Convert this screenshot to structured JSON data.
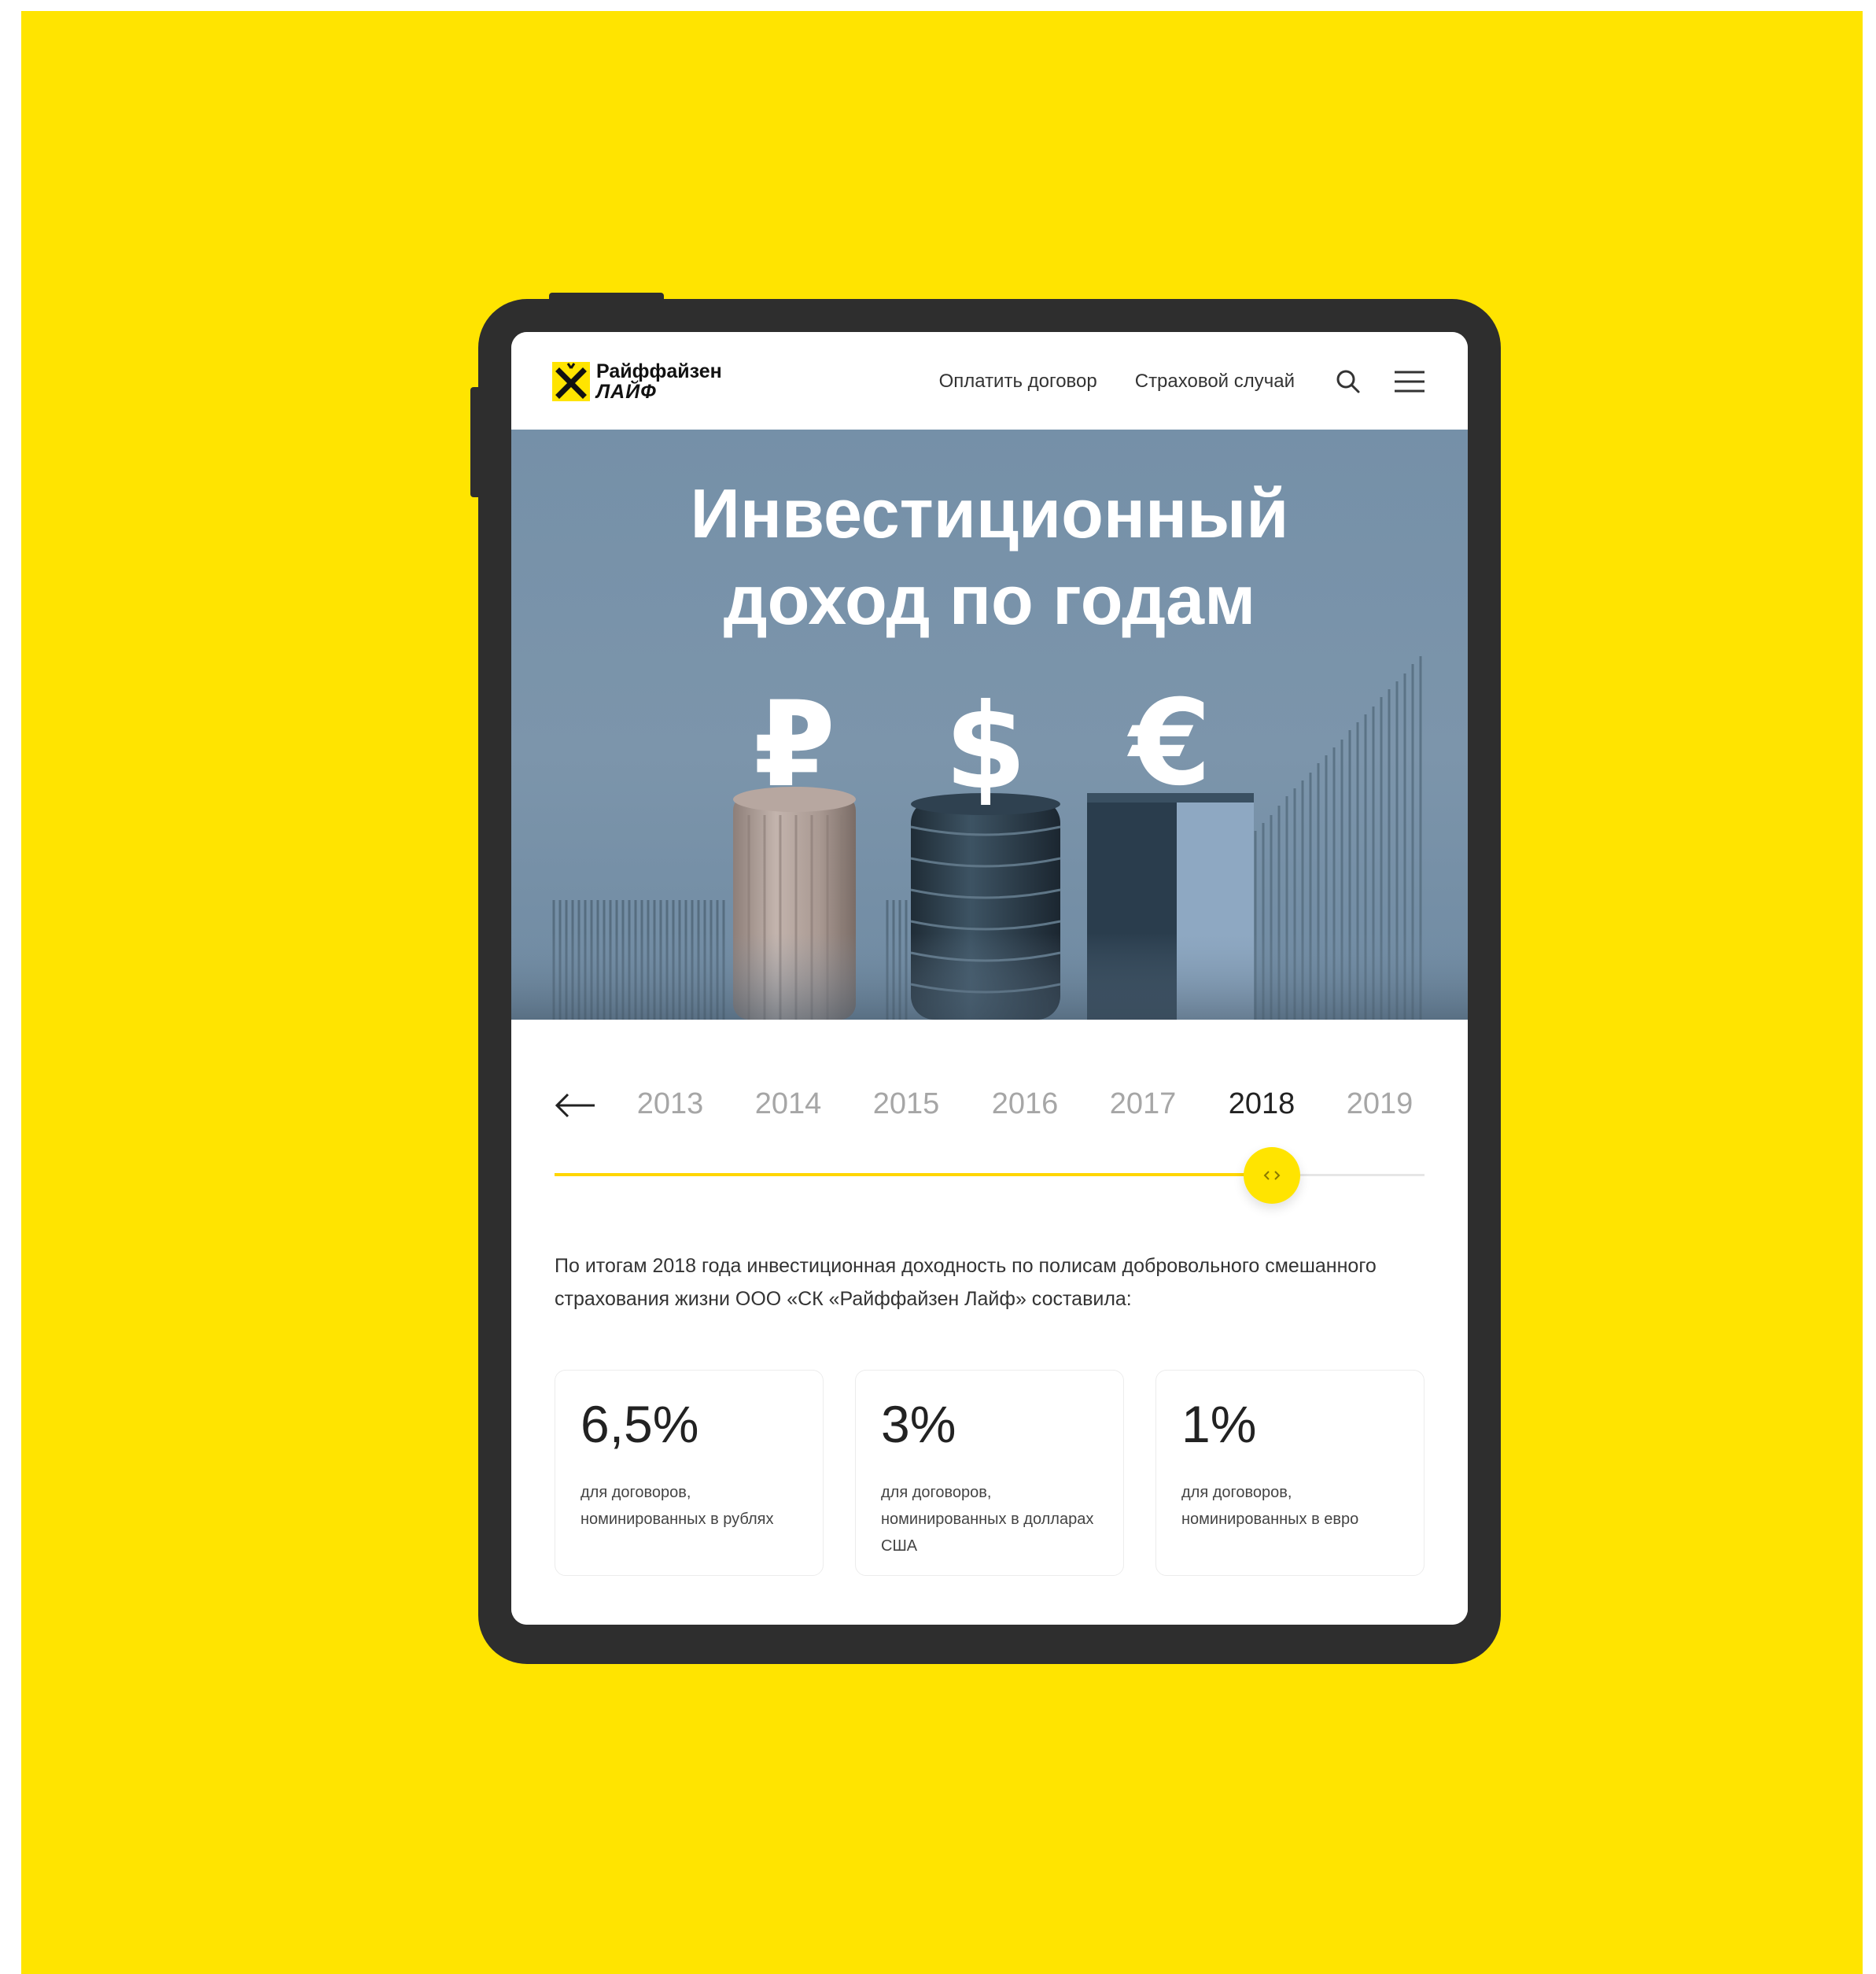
{
  "colors": {
    "brand_yellow": "#FFE400",
    "device": "#2e2e2e",
    "hero_bg": "#7590a8"
  },
  "header": {
    "logo_line1": "Райффайзен",
    "logo_line2": "ЛАЙФ",
    "nav": [
      {
        "label": "Оплатить договор"
      },
      {
        "label": "Страховой случай"
      }
    ],
    "icons": [
      "search-icon",
      "menu-icon"
    ]
  },
  "hero": {
    "title_line1": "Инвестиционный",
    "title_line2": "доход по годам",
    "currency_symbols": [
      "₽",
      "$",
      "€"
    ]
  },
  "timeline": {
    "years": [
      "2013",
      "2014",
      "2015",
      "2016",
      "2017",
      "2018",
      "2019"
    ],
    "selected": "2018",
    "progress_fraction": 0.825
  },
  "description": "По итогам 2018 года инвестиционная доходность по полисам добровольного смешанного страхования жизни ООО «СК «Райффайзен Лайф» составила:",
  "stats": [
    {
      "value": "6,5%",
      "label": "для договоров, номинированных в рублях"
    },
    {
      "value": "3%",
      "label": "для договоров, номинированных в долларах США"
    },
    {
      "value": "1%",
      "label": "для договоров, номинированных в евро"
    }
  ]
}
